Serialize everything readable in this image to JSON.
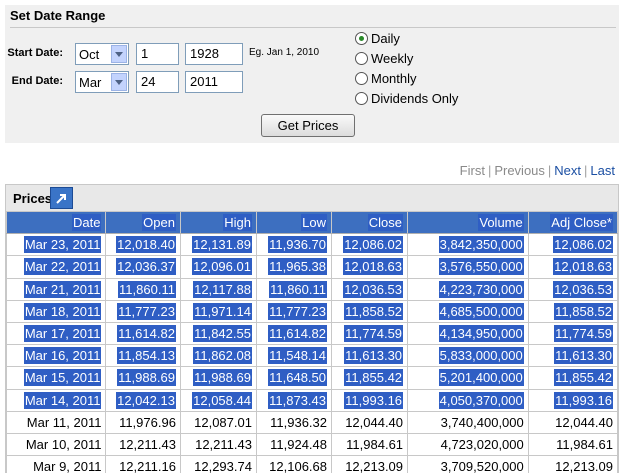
{
  "range": {
    "title": "Set Date Range",
    "start_label": "Start Date:",
    "end_label": "End Date:",
    "start_month": "Oct",
    "start_day": "1",
    "start_year": "1928",
    "end_month": "Mar",
    "end_day": "24",
    "end_year": "2011",
    "hint": "Eg. Jan 1, 2010",
    "frequency": [
      {
        "label": "Daily",
        "selected": true
      },
      {
        "label": "Weekly",
        "selected": false
      },
      {
        "label": "Monthly",
        "selected": false
      },
      {
        "label": "Dividends Only",
        "selected": false
      }
    ],
    "submit_label": "Get Prices"
  },
  "pager": {
    "first": "First",
    "previous": "Previous",
    "next": "Next",
    "last": "Last"
  },
  "prices": {
    "title": "Prices",
    "columns": [
      "Date",
      "Open",
      "High",
      "Low",
      "Close",
      "Volume",
      "Adj Close*"
    ],
    "rows": [
      {
        "cells": [
          "Mar 23, 2011",
          "12,018.40",
          "12,131.89",
          "11,936.70",
          "12,086.02",
          "3,842,350,000",
          "12,086.02"
        ],
        "selected": true
      },
      {
        "cells": [
          "Mar 22, 2011",
          "12,036.37",
          "12,096.01",
          "11,965.38",
          "12,018.63",
          "3,576,550,000",
          "12,018.63"
        ],
        "selected": true
      },
      {
        "cells": [
          "Mar 21, 2011",
          "11,860.11",
          "12,117.88",
          "11,860.11",
          "12,036.53",
          "4,223,730,000",
          "12,036.53"
        ],
        "selected": true
      },
      {
        "cells": [
          "Mar 18, 2011",
          "11,777.23",
          "11,971.14",
          "11,777.23",
          "11,858.52",
          "4,685,500,000",
          "11,858.52"
        ],
        "selected": true
      },
      {
        "cells": [
          "Mar 17, 2011",
          "11,614.82",
          "11,842.55",
          "11,614.82",
          "11,774.59",
          "4,134,950,000",
          "11,774.59"
        ],
        "selected": true
      },
      {
        "cells": [
          "Mar 16, 2011",
          "11,854.13",
          "11,862.08",
          "11,548.14",
          "11,613.30",
          "5,833,000,000",
          "11,613.30"
        ],
        "selected": true
      },
      {
        "cells": [
          "Mar 15, 2011",
          "11,988.69",
          "11,988.69",
          "11,648.50",
          "11,855.42",
          "5,201,400,000",
          "11,855.42"
        ],
        "selected": true
      },
      {
        "cells": [
          "Mar 14, 2011",
          "12,042.13",
          "12,058.44",
          "11,873.43",
          "11,993.16",
          "4,050,370,000",
          "11,993.16"
        ],
        "selected": true
      },
      {
        "cells": [
          "Mar 11, 2011",
          "11,976.96",
          "12,087.01",
          "11,936.32",
          "12,044.40",
          "3,740,400,000",
          "12,044.40"
        ],
        "selected": false
      },
      {
        "cells": [
          "Mar 10, 2011",
          "12,211.43",
          "12,211.43",
          "11,924.48",
          "11,984.61",
          "4,723,020,000",
          "11,984.61"
        ],
        "selected": false
      },
      {
        "cells": [
          "Mar 9, 2011",
          "12,211.16",
          "12,293.74",
          "12,106.68",
          "12,213.09",
          "3,709,520,000",
          "12,213.09"
        ],
        "selected": false
      }
    ]
  }
}
